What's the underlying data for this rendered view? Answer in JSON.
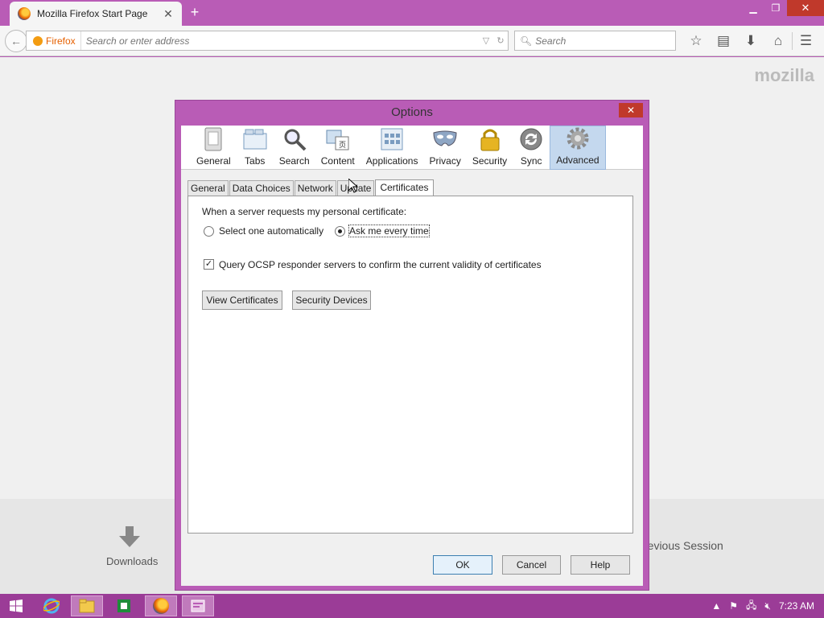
{
  "browser": {
    "tab_title": "Mozilla Firefox Start Page",
    "new_tab": "+",
    "identity_label": "Firefox",
    "url_placeholder": "Search or enter address",
    "search_placeholder": "Search"
  },
  "page": {
    "logo": "mozilla",
    "downloads_label": "Downloads",
    "restore_label": "revious Session"
  },
  "dialog": {
    "title": "Options",
    "panes": [
      "General",
      "Tabs",
      "Search",
      "Content",
      "Applications",
      "Privacy",
      "Security",
      "Sync",
      "Advanced"
    ],
    "selected_pane": "Advanced",
    "subtabs": [
      "General",
      "Data Choices",
      "Network",
      "Update",
      "Certificates"
    ],
    "active_subtab": "Certificates",
    "cert_prompt": "When a server requests my personal certificate:",
    "radio_auto": "Select one automatically",
    "radio_ask": "Ask me every time",
    "ocsp": "Query OCSP responder servers to confirm the current validity of certificates",
    "view_certs": "View Certificates",
    "security_devices": "Security Devices",
    "ok": "OK",
    "cancel": "Cancel",
    "help": "Help"
  },
  "taskbar": {
    "clock": "7:23 AM"
  }
}
